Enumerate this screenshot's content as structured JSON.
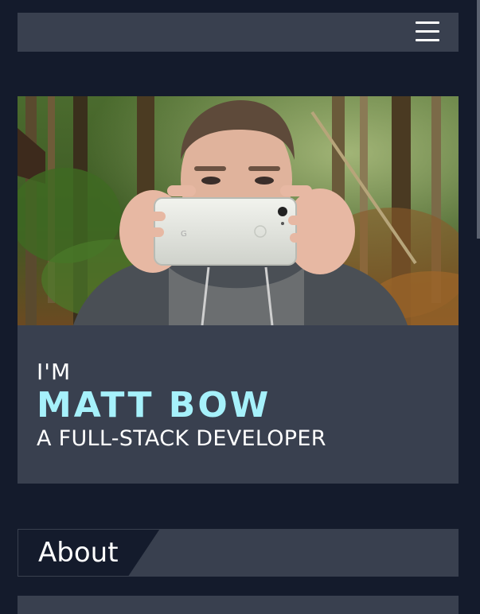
{
  "header": {
    "menu_icon": "hamburger-menu-icon"
  },
  "hero": {
    "photo_alt": "Photo of a man holding up a white smartphone in a forest",
    "intro": "I'M",
    "name": "MATT BOW",
    "role": "A FULL-STACK DEVELOPER"
  },
  "sections": {
    "about_title": "About"
  },
  "colors": {
    "background": "#141b2c",
    "card": "#39404f",
    "accent": "#a6f1fb",
    "text": "#ffffff"
  }
}
